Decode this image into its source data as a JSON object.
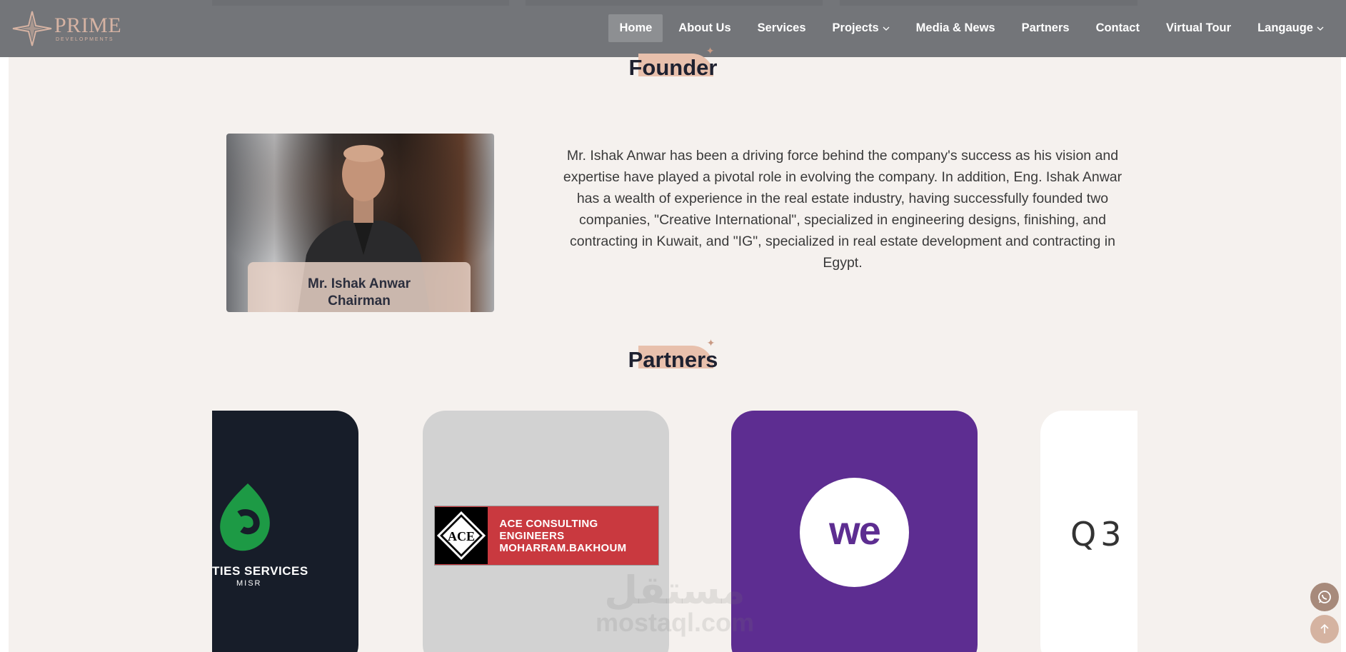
{
  "header": {
    "logo": {
      "name": "PRIME",
      "subtitle": "DEVELOPMENTS"
    },
    "nav": [
      {
        "label": "Home",
        "active": true
      },
      {
        "label": "About Us"
      },
      {
        "label": "Services"
      },
      {
        "label": "Projects",
        "dropdown": true
      },
      {
        "label": "Media & News"
      },
      {
        "label": "Partners"
      },
      {
        "label": "Contact"
      },
      {
        "label": "Virtual Tour"
      },
      {
        "label": "Langauge",
        "dropdown": true
      }
    ]
  },
  "founder": {
    "title": "Founder",
    "name": "Mr. Ishak Anwar",
    "role": "Chairman",
    "bio": "Mr. Ishak Anwar has been a driving force behind the company's success as his vision and expertise have played a pivotal role in evolving the company. In addition, Eng. Ishak Anwar has a wealth of experience in the real estate industry, having successfully founded two companies, \"Creative International\", specialized in engineering designs, finishing, and contracting in Kuwait, and \"IG\", specialized in real estate development and contracting in Egypt."
  },
  "partners": {
    "title": "Partners",
    "cards": [
      {
        "logo_text": "TIES SERVICES",
        "logo_subtext": "MISR",
        "bg": "#171d29"
      },
      {
        "logo_mark": "ACE",
        "logo_text_line1": "ACE CONSULTING ENGINEERS",
        "logo_text_line2": "MOHARRAM.BAKHOUM",
        "bg": "#d2d2d2"
      },
      {
        "logo_text": "we",
        "bg": "#5d2d91"
      },
      {
        "logo_text": "Q3 /",
        "bg": "#ffffff"
      }
    ]
  },
  "watermark": {
    "arabic": "مستقل",
    "latin": "mostaql.com"
  },
  "floating": {
    "whatsapp_icon": "whatsapp-icon",
    "scroll_top_icon": "arrow-up-icon"
  },
  "colors": {
    "accent": "#d6b3a3",
    "header_bg": "#6e7175",
    "page_bg": "#f5f1ee"
  }
}
